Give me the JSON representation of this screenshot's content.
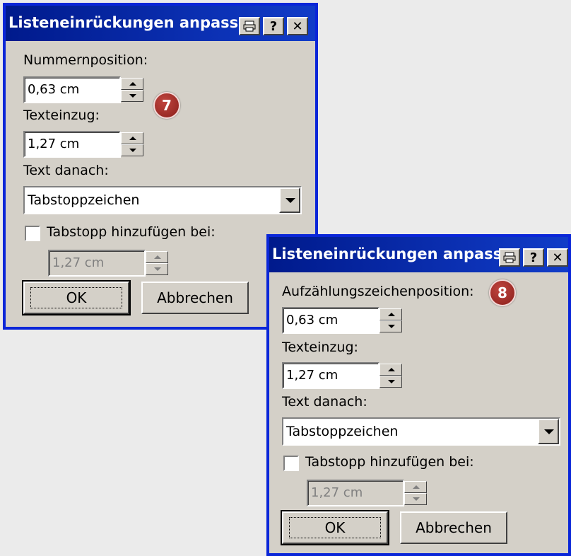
{
  "dialog1": {
    "title": "Listeneinrückungen anpassen",
    "number_position_label": "Nummernposition:",
    "number_position_value": "0,63 cm",
    "text_indent_label": "Texteinzug:",
    "text_indent_value": "1,27 cm",
    "text_after_label": "Text danach:",
    "text_after_value": "Tabstoppzeichen",
    "tab_checkbox_label": "Tabstopp hinzufügen bei:",
    "tab_position_value": "1,27 cm",
    "ok_label": "OK",
    "cancel_label": "Abbrechen",
    "badge": "7"
  },
  "dialog2": {
    "title": "Listeneinrückungen anpassen",
    "bullet_position_label": "Aufzählungszeichenposition:",
    "bullet_position_value": "0,63 cm",
    "text_indent_label": "Texteinzug:",
    "text_indent_value": "1,27 cm",
    "text_after_label": "Text danach:",
    "text_after_value": "Tabstoppzeichen",
    "tab_checkbox_label": "Tabstopp hinzufügen bei:",
    "tab_position_value": "1,27 cm",
    "ok_label": "OK",
    "cancel_label": "Abbrechen",
    "badge": "8"
  },
  "titlebar_buttons": {
    "help": "?",
    "close": "✕"
  },
  "colors": {
    "frame": "#0a26d8",
    "titlebar": "#001a8c",
    "dialog_bg": "#d4d0c8",
    "badge": "#a12c26"
  }
}
